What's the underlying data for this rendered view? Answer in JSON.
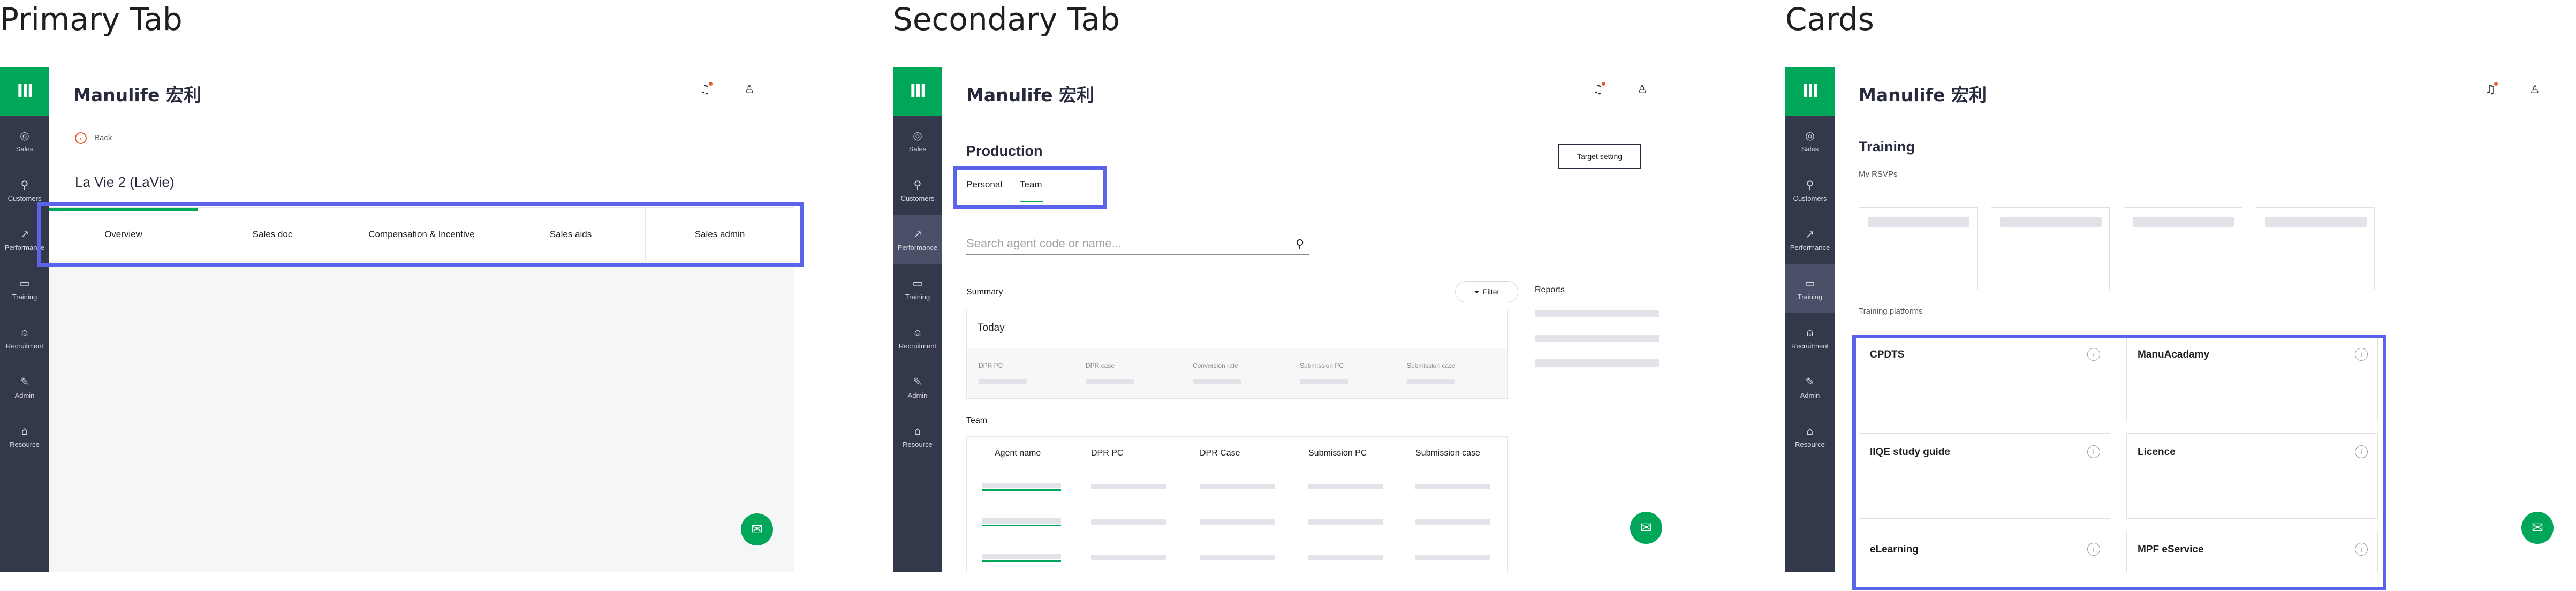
{
  "brand": "Manulife 宏利",
  "nav": [
    {
      "label": "Sales",
      "icon": "target-icon",
      "glyph": "◎"
    },
    {
      "label": "Customers",
      "icon": "search-person-icon",
      "glyph": "⚲"
    },
    {
      "label": "Performance",
      "icon": "trend-icon",
      "glyph": "↗"
    },
    {
      "label": "Training",
      "icon": "book-icon",
      "glyph": "▭"
    },
    {
      "label": "Recruitment",
      "icon": "people-icon",
      "glyph": "⍝"
    },
    {
      "label": "Admin",
      "icon": "edit-icon",
      "glyph": "✎"
    },
    {
      "label": "Resource",
      "icon": "bank-icon",
      "glyph": "⌂"
    }
  ],
  "colors": {
    "accent": "#00a758",
    "sidebar": "#34384b",
    "highlight": "#5b63e8"
  },
  "panels": {
    "primary": {
      "title": "Primary Tab",
      "back": "Back",
      "page_title": "La Vie 2 (LaVie)",
      "tabs": [
        "Overview",
        "Sales doc",
        "Compensation & Incentive",
        "Sales aids",
        "Sales admin"
      ],
      "active_tab": "Overview"
    },
    "secondary": {
      "title": "Secondary Tab",
      "page_title": "Production",
      "target_button": "Target setting",
      "tabs": [
        "Personal",
        "Team"
      ],
      "active_tab": "Team",
      "search_placeholder": "Search agent code or name...",
      "summary_label": "Summary",
      "filter_label": "Filter",
      "reports_label": "Reports",
      "today_label": "Today",
      "metrics": [
        "DPR PC",
        "DPR case",
        "Conversion rate",
        "Submission PC",
        "Submission case"
      ],
      "team_label": "Team",
      "columns": [
        "Agent name",
        "DPR PC",
        "DPR Case",
        "Submission PC",
        "Submission case"
      ]
    },
    "cards": {
      "title": "Cards",
      "page_title": "Training",
      "rsvps_label": "My RSVPs",
      "platforms_label": "Training platforms",
      "platforms": [
        "CPDTS",
        "ManuAcadamy",
        "IIQE study guide",
        "Licence",
        "eLearning",
        "MPF eService"
      ]
    }
  }
}
